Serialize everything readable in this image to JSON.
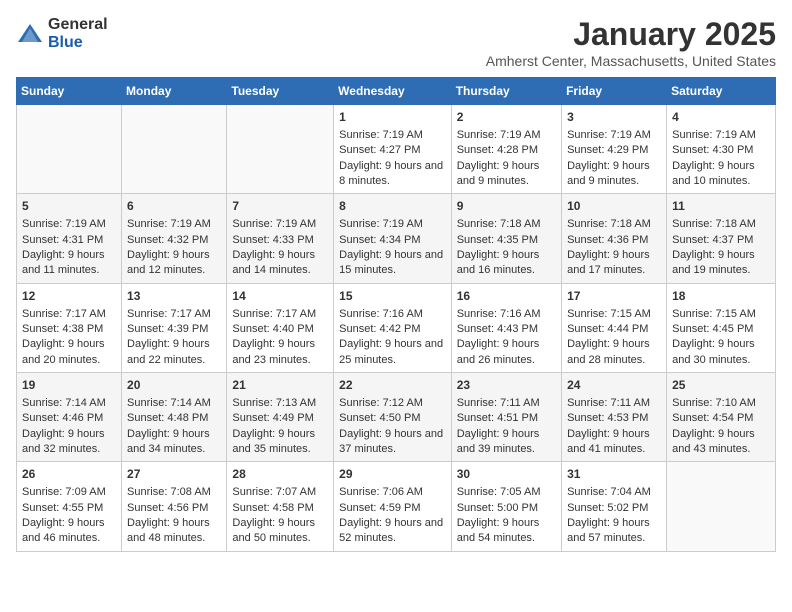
{
  "header": {
    "logo_general": "General",
    "logo_blue": "Blue",
    "title": "January 2025",
    "subtitle": "Amherst Center, Massachusetts, United States"
  },
  "days_of_week": [
    "Sunday",
    "Monday",
    "Tuesday",
    "Wednesday",
    "Thursday",
    "Friday",
    "Saturday"
  ],
  "weeks": [
    [
      {
        "day": "",
        "content": ""
      },
      {
        "day": "",
        "content": ""
      },
      {
        "day": "",
        "content": ""
      },
      {
        "day": "1",
        "content": "Sunrise: 7:19 AM\nSunset: 4:27 PM\nDaylight: 9 hours and 8 minutes."
      },
      {
        "day": "2",
        "content": "Sunrise: 7:19 AM\nSunset: 4:28 PM\nDaylight: 9 hours and 9 minutes."
      },
      {
        "day": "3",
        "content": "Sunrise: 7:19 AM\nSunset: 4:29 PM\nDaylight: 9 hours and 9 minutes."
      },
      {
        "day": "4",
        "content": "Sunrise: 7:19 AM\nSunset: 4:30 PM\nDaylight: 9 hours and 10 minutes."
      }
    ],
    [
      {
        "day": "5",
        "content": "Sunrise: 7:19 AM\nSunset: 4:31 PM\nDaylight: 9 hours and 11 minutes."
      },
      {
        "day": "6",
        "content": "Sunrise: 7:19 AM\nSunset: 4:32 PM\nDaylight: 9 hours and 12 minutes."
      },
      {
        "day": "7",
        "content": "Sunrise: 7:19 AM\nSunset: 4:33 PM\nDaylight: 9 hours and 14 minutes."
      },
      {
        "day": "8",
        "content": "Sunrise: 7:19 AM\nSunset: 4:34 PM\nDaylight: 9 hours and 15 minutes."
      },
      {
        "day": "9",
        "content": "Sunrise: 7:18 AM\nSunset: 4:35 PM\nDaylight: 9 hours and 16 minutes."
      },
      {
        "day": "10",
        "content": "Sunrise: 7:18 AM\nSunset: 4:36 PM\nDaylight: 9 hours and 17 minutes."
      },
      {
        "day": "11",
        "content": "Sunrise: 7:18 AM\nSunset: 4:37 PM\nDaylight: 9 hours and 19 minutes."
      }
    ],
    [
      {
        "day": "12",
        "content": "Sunrise: 7:17 AM\nSunset: 4:38 PM\nDaylight: 9 hours and 20 minutes."
      },
      {
        "day": "13",
        "content": "Sunrise: 7:17 AM\nSunset: 4:39 PM\nDaylight: 9 hours and 22 minutes."
      },
      {
        "day": "14",
        "content": "Sunrise: 7:17 AM\nSunset: 4:40 PM\nDaylight: 9 hours and 23 minutes."
      },
      {
        "day": "15",
        "content": "Sunrise: 7:16 AM\nSunset: 4:42 PM\nDaylight: 9 hours and 25 minutes."
      },
      {
        "day": "16",
        "content": "Sunrise: 7:16 AM\nSunset: 4:43 PM\nDaylight: 9 hours and 26 minutes."
      },
      {
        "day": "17",
        "content": "Sunrise: 7:15 AM\nSunset: 4:44 PM\nDaylight: 9 hours and 28 minutes."
      },
      {
        "day": "18",
        "content": "Sunrise: 7:15 AM\nSunset: 4:45 PM\nDaylight: 9 hours and 30 minutes."
      }
    ],
    [
      {
        "day": "19",
        "content": "Sunrise: 7:14 AM\nSunset: 4:46 PM\nDaylight: 9 hours and 32 minutes."
      },
      {
        "day": "20",
        "content": "Sunrise: 7:14 AM\nSunset: 4:48 PM\nDaylight: 9 hours and 34 minutes."
      },
      {
        "day": "21",
        "content": "Sunrise: 7:13 AM\nSunset: 4:49 PM\nDaylight: 9 hours and 35 minutes."
      },
      {
        "day": "22",
        "content": "Sunrise: 7:12 AM\nSunset: 4:50 PM\nDaylight: 9 hours and 37 minutes."
      },
      {
        "day": "23",
        "content": "Sunrise: 7:11 AM\nSunset: 4:51 PM\nDaylight: 9 hours and 39 minutes."
      },
      {
        "day": "24",
        "content": "Sunrise: 7:11 AM\nSunset: 4:53 PM\nDaylight: 9 hours and 41 minutes."
      },
      {
        "day": "25",
        "content": "Sunrise: 7:10 AM\nSunset: 4:54 PM\nDaylight: 9 hours and 43 minutes."
      }
    ],
    [
      {
        "day": "26",
        "content": "Sunrise: 7:09 AM\nSunset: 4:55 PM\nDaylight: 9 hours and 46 minutes."
      },
      {
        "day": "27",
        "content": "Sunrise: 7:08 AM\nSunset: 4:56 PM\nDaylight: 9 hours and 48 minutes."
      },
      {
        "day": "28",
        "content": "Sunrise: 7:07 AM\nSunset: 4:58 PM\nDaylight: 9 hours and 50 minutes."
      },
      {
        "day": "29",
        "content": "Sunrise: 7:06 AM\nSunset: 4:59 PM\nDaylight: 9 hours and 52 minutes."
      },
      {
        "day": "30",
        "content": "Sunrise: 7:05 AM\nSunset: 5:00 PM\nDaylight: 9 hours and 54 minutes."
      },
      {
        "day": "31",
        "content": "Sunrise: 7:04 AM\nSunset: 5:02 PM\nDaylight: 9 hours and 57 minutes."
      },
      {
        "day": "",
        "content": ""
      }
    ]
  ]
}
